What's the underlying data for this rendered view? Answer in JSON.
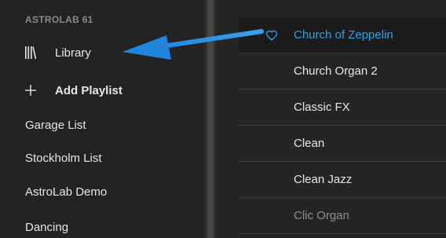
{
  "sidebar": {
    "device_name": "ASTROLAB 61",
    "library": {
      "label": "Library",
      "icon": "library-icon"
    },
    "add_playlist": {
      "label": "Add Playlist",
      "icon": "plus-icon"
    },
    "playlists": [
      {
        "label": "Garage List"
      },
      {
        "label": "Stockholm List"
      },
      {
        "label": "AstroLab Demo"
      },
      {
        "label": "Dancing"
      }
    ]
  },
  "presets": [
    {
      "name": "Church of Zeppelin",
      "selected": true
    },
    {
      "name": "Church Organ 2"
    },
    {
      "name": "Classic FX"
    },
    {
      "name": "Clean"
    },
    {
      "name": "Clean Jazz"
    },
    {
      "name": "Clic Organ"
    }
  ],
  "colors": {
    "accent": "#24a6ea",
    "arrow": "#2b8fde",
    "background": "#232323",
    "text": "#e6e6e6"
  }
}
